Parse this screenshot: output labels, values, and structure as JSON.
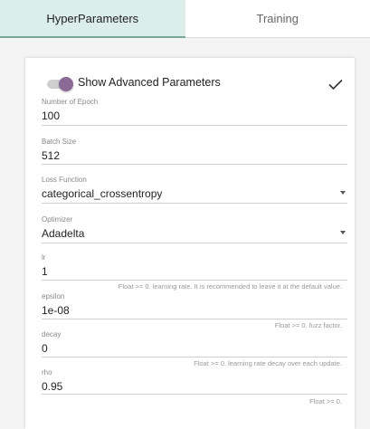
{
  "tabs": [
    {
      "label": "HyperParameters",
      "active": true
    },
    {
      "label": "Training",
      "active": false
    }
  ],
  "advanced": {
    "label": "Show Advanced Parameters",
    "enabled": true
  },
  "fields": {
    "epochs": {
      "label": "Number of Epoch",
      "value": "100"
    },
    "batch": {
      "label": "Batch Size",
      "value": "512"
    },
    "loss": {
      "label": "Loss Function",
      "value": "categorical_crossentropy"
    },
    "optimizer": {
      "label": "Optimizer",
      "value": "Adadelta"
    },
    "lr": {
      "label": "lr",
      "value": "1",
      "hint": "Float >= 0. learning rate. It is recommended to leave it at the default value."
    },
    "epsilon": {
      "label": "epsilon",
      "value": "1e-08",
      "hint": "Float >= 0. fuzz factor."
    },
    "decay": {
      "label": "decay",
      "value": "0",
      "hint": "Float >= 0. learning rate decay over each update."
    },
    "rho": {
      "label": "rho",
      "value": "0.95",
      "hint": "Float >= 0."
    }
  },
  "colors": {
    "tab_active_bg": "#dbeee9",
    "tab_active_border": "#78a89a",
    "toggle_knob": "#8c6a97"
  },
  "icons": {
    "confirm": "check-icon",
    "dropdown": "chevron-down-icon"
  }
}
